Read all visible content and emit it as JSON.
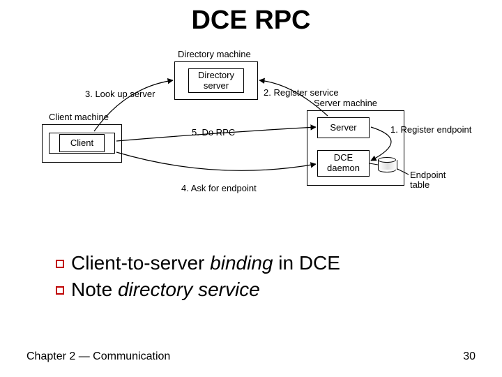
{
  "title": "DCE RPC",
  "diagram": {
    "machines": {
      "client": {
        "label": "Client machine",
        "box": "Client"
      },
      "directory": {
        "label": "Directory machine",
        "box": "Directory\nserver"
      },
      "server": {
        "label": "Server machine",
        "server_box": "Server",
        "daemon_box": "DCE\ndaemon",
        "endpoint_label": "Endpoint\ntable"
      }
    },
    "steps": {
      "s1": "1. Register endpoint",
      "s2": "2. Register service",
      "s3": "3. Look up server",
      "s4": "4. Ask for endpoint",
      "s5": "5. Do RPC"
    }
  },
  "bullets": [
    {
      "pre": "Client-to-server ",
      "em": "binding",
      "post": " in DCE"
    },
    {
      "pre": "Note ",
      "em": "directory service",
      "post": ""
    }
  ],
  "footer": {
    "left": "Chapter 2 — Communication",
    "page": "30"
  }
}
